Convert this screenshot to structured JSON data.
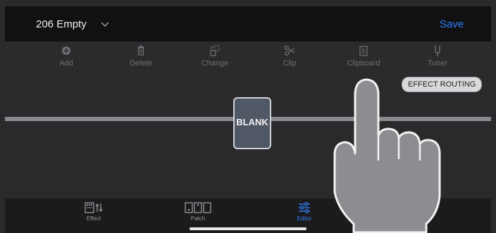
{
  "header": {
    "patch_name": "206 Empty",
    "save_label": "Save"
  },
  "toolbar": {
    "items": [
      {
        "label": "Add",
        "icon": "plus-circle-icon"
      },
      {
        "label": "Delete",
        "icon": "trash-icon"
      },
      {
        "label": "Change",
        "icon": "swap-icon"
      },
      {
        "label": "Clip",
        "icon": "scissors-icon"
      },
      {
        "label": "Clipboard",
        "icon": "clipboard-icon"
      },
      {
        "label": "Tuner",
        "icon": "tuning-fork-icon"
      }
    ]
  },
  "canvas": {
    "routing_label": "EFFECT ROUTING",
    "block_label": "BLANK"
  },
  "tabs": {
    "items": [
      {
        "label": "Effect",
        "icon": "effect-icon",
        "active": false
      },
      {
        "label": "Patch",
        "icon": "patch-icon",
        "active": false
      },
      {
        "label": "Editor",
        "icon": "editor-icon",
        "active": true
      }
    ]
  },
  "colors": {
    "accent": "#2d7cf6",
    "toolbar_disabled": "#6f6f73",
    "block_fill": "#505866"
  }
}
